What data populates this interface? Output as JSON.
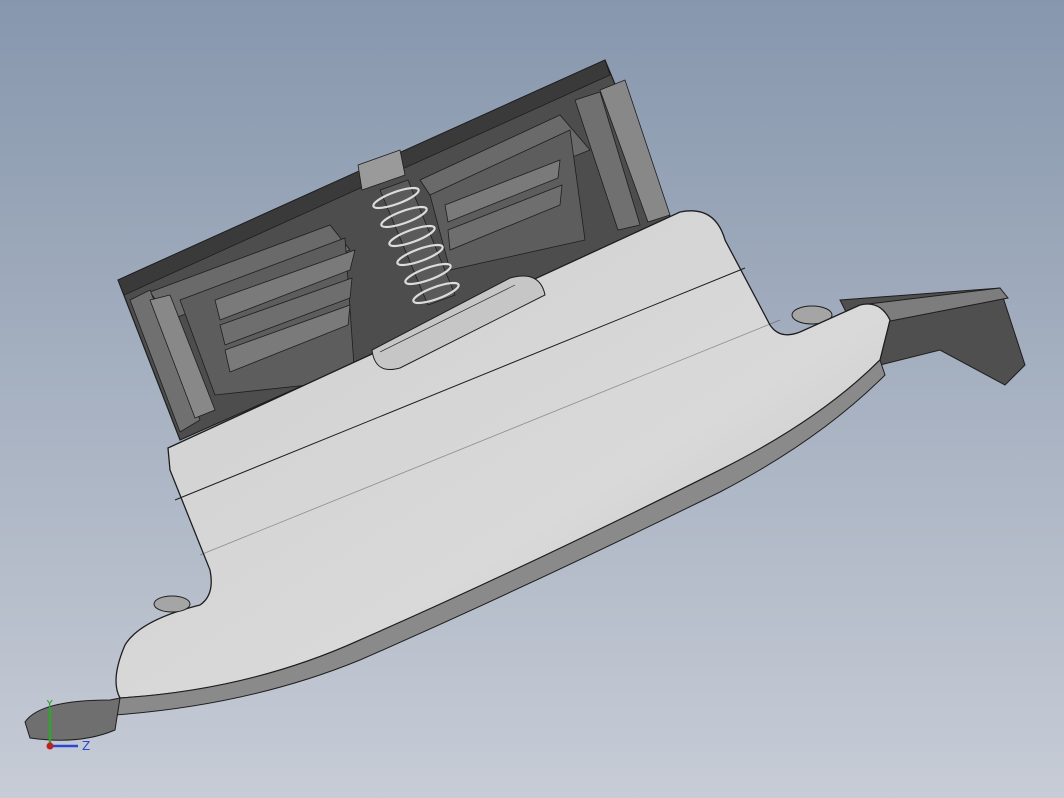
{
  "viewport": {
    "background_top": "#8797ad",
    "background_bottom": "#c7ccd6",
    "model_color": "#d7d7d7",
    "dark_color": "#545454",
    "edge_color": "#1e1e1e"
  },
  "triad": {
    "y_label": "Y",
    "z_label": "Z",
    "y_color": "#2fa52f",
    "z_color": "#2c46d1",
    "x_color": "#c02020"
  }
}
